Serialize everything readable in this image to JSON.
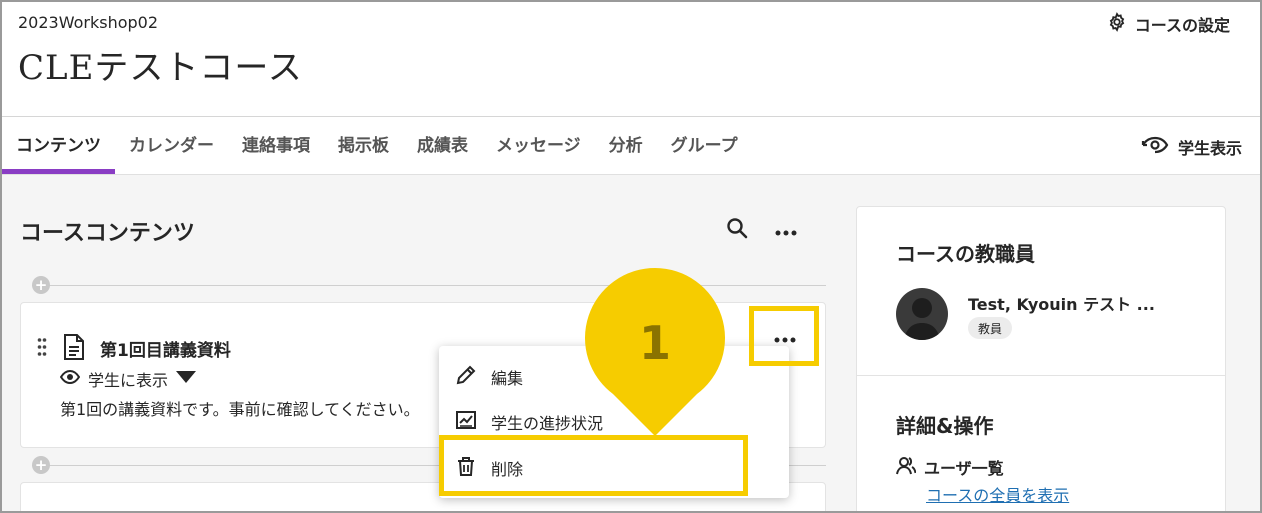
{
  "header": {
    "course_code": "2023Workshop02",
    "course_title": "CLEテストコース",
    "settings_label": "コースの設定",
    "student_view_label": "学生表示"
  },
  "nav": {
    "tabs": [
      {
        "label": "コンテンツ",
        "active": true
      },
      {
        "label": "カレンダー",
        "active": false
      },
      {
        "label": "連絡事項",
        "active": false
      },
      {
        "label": "掲示板",
        "active": false
      },
      {
        "label": "成績表",
        "active": false
      },
      {
        "label": "メッセージ",
        "active": false
      },
      {
        "label": "分析",
        "active": false
      },
      {
        "label": "グループ",
        "active": false
      }
    ],
    "active_color": "#8a3dc4"
  },
  "content": {
    "section_title": "コースコンテンツ",
    "item": {
      "title": "第1回目講義資料",
      "visibility": "学生に表示",
      "description": "第1回の講義資料です。事前に確認してください。"
    }
  },
  "menu": {
    "items": [
      {
        "label": "編集",
        "icon": "pencil-icon"
      },
      {
        "label": "学生の進捗状況",
        "icon": "progress-chart-icon"
      },
      {
        "label": "削除",
        "icon": "trash-icon"
      }
    ]
  },
  "callout": {
    "number": "1",
    "color": "#f6cc00"
  },
  "sidebar": {
    "staff_title": "コースの教職員",
    "staff_name": "Test, Kyouin テスト ...",
    "staff_role": "教員",
    "details_title": "詳細&操作",
    "users_label": "ユーザ一覧",
    "users_link": "コースの全員を表示"
  }
}
